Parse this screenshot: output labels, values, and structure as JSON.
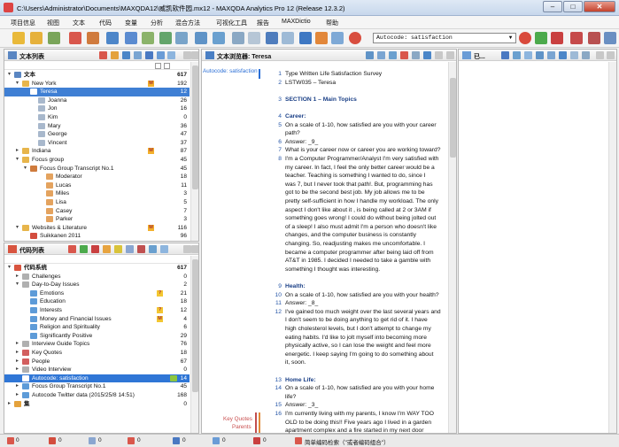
{
  "window": {
    "title": "C:\\Users\\Administrator\\Documents\\MAXQDA12\\威凯软件园.mx12 - MAXQDA Analytics Pro 12 (Release 12.3.2)",
    "minimize": "–",
    "maximize": "□",
    "close": "✕"
  },
  "menu": [
    "项目信息",
    "视图",
    "文本",
    "代码",
    "变量",
    "分析",
    "混合方法",
    "可视化工具",
    "报告",
    "MAXDictio",
    "帮助"
  ],
  "toolbar": {
    "code_select_value": "Autocode: satisfaction"
  },
  "doc_system": {
    "title": "文本列表",
    "rows": [
      {
        "label": "文本",
        "count": "617"
      },
      {
        "label": "New York",
        "count": "192"
      },
      {
        "label": "Teresa",
        "count": "12"
      },
      {
        "label": "Joanna",
        "count": "26"
      },
      {
        "label": "Jon",
        "count": "16"
      },
      {
        "label": "Kim",
        "count": "0"
      },
      {
        "label": "Mary",
        "count": "36"
      },
      {
        "label": "George",
        "count": "47"
      },
      {
        "label": "Vincent",
        "count": "37"
      },
      {
        "label": "Indiana",
        "count": "87"
      },
      {
        "label": "Focus group",
        "count": "45"
      },
      {
        "label": "Focus Group Transcript No.1",
        "count": "45"
      },
      {
        "label": "Moderator",
        "count": "18"
      },
      {
        "label": "Lucas",
        "count": "11"
      },
      {
        "label": "Miles",
        "count": "3"
      },
      {
        "label": "Lisa",
        "count": "5"
      },
      {
        "label": "Casey",
        "count": "7"
      },
      {
        "label": "Parker",
        "count": "3"
      },
      {
        "label": "Websites & Literature",
        "count": "116"
      },
      {
        "label": "Suikkanen 2011",
        "count": "96"
      }
    ]
  },
  "code_system": {
    "title": "代码列表",
    "rows": [
      {
        "label": "代码系统",
        "count": "617"
      },
      {
        "label": "Challenges",
        "count": "0"
      },
      {
        "label": "Day-to-Day Issues",
        "count": "2"
      },
      {
        "label": "Emotions",
        "count": "21"
      },
      {
        "label": "Education",
        "count": "18"
      },
      {
        "label": "Interests",
        "count": "12"
      },
      {
        "label": "Money and Financial Issues",
        "count": "4"
      },
      {
        "label": "Religion and Spirituality",
        "count": "6"
      },
      {
        "label": "Significantly Positive",
        "count": "29"
      },
      {
        "label": "Interview Guide Topics",
        "count": "76"
      },
      {
        "label": "Key Quotes",
        "count": "18"
      },
      {
        "label": "People",
        "count": "67"
      },
      {
        "label": "Video Interview",
        "count": "0"
      },
      {
        "label": "Autocode: satisfaction",
        "count": "14"
      },
      {
        "label": "Focus Group Transcript No.1",
        "count": "45"
      },
      {
        "label": "Autocode Twitter data (2015/25/8 14:51)",
        "count": "168"
      },
      {
        "label": "集",
        "count": "0"
      }
    ]
  },
  "doc_browser": {
    "title": "文本浏览器: Teresa",
    "code_label": "Autocode: satisfaction",
    "margin_label_1": "Key Quotes",
    "margin_label_2": "Parents",
    "lines": [
      {
        "n": "1",
        "t": "Type Written Life Satisfaction Survey",
        "b": false
      },
      {
        "n": "2",
        "t": "LSTW035 – Teresa",
        "b": false
      },
      {
        "n": "",
        "t": "",
        "b": false
      },
      {
        "n": "3",
        "t": "SECTION 1 – Main Topics",
        "b": true
      },
      {
        "n": "",
        "t": "",
        "b": false
      },
      {
        "n": "4",
        "t": "Career:",
        "b": true
      },
      {
        "n": "5",
        "t": "On a scale of 1-10, how satisfied are you with your career",
        "b": false
      },
      {
        "n": "",
        "t": "path?",
        "b": false
      },
      {
        "n": "6",
        "t": "Answer: _9_",
        "b": false
      },
      {
        "n": "7",
        "t": "What is your career now or career you are working toward?",
        "b": false
      },
      {
        "n": "8",
        "t": "I'm a Computer Programmer/Analyst I'm very satisfied with",
        "b": false
      },
      {
        "n": "",
        "t": "my career.  In fact, I feel the only better career would be a",
        "b": false
      },
      {
        "n": "",
        "t": "teacher.  Teaching is something I wanted to do, since I",
        "b": false
      },
      {
        "n": "",
        "t": "was 7, but I never took that path!. But, programming has",
        "b": false
      },
      {
        "n": "",
        "t": "got to be the second best job.  My job allows me to be",
        "b": false
      },
      {
        "n": "",
        "t": "pretty self-sufficient in how I handle my workload.  The only",
        "b": false
      },
      {
        "n": "",
        "t": "aspect I don't like about it , is being called at 2 or 3AM  if",
        "b": false
      },
      {
        "n": "",
        "t": "something goes wrong!  I could do without being jolted out",
        "b": false
      },
      {
        "n": "",
        "t": "of a sleep!  I also must admit I'm a person who doesn't like",
        "b": false
      },
      {
        "n": "",
        "t": "changes, and the computer business is constantly",
        "b": false
      },
      {
        "n": "",
        "t": "changing.  So, readjusting makes me uncomfortable.  I",
        "b": false
      },
      {
        "n": "",
        "t": "became a computer programmer after being laid off from",
        "b": false
      },
      {
        "n": "",
        "t": "AT&T in 1985.  I decided I needed to take a gamble with",
        "b": false
      },
      {
        "n": "",
        "t": "something I thought was interesting.",
        "b": false
      },
      {
        "n": "",
        "t": "",
        "b": false
      },
      {
        "n": "9",
        "t": "Health:",
        "b": true
      },
      {
        "n": "10",
        "t": "On a scale of 1-10, how satisfied are you with your health?",
        "b": false
      },
      {
        "n": "11",
        "t": "Answer: _8_",
        "b": false
      },
      {
        "n": "12",
        "t": "I've gained too much weight over the last several years and",
        "b": false
      },
      {
        "n": "",
        "t": "I don't seem to be doing anything to get rid of it.  I have",
        "b": false
      },
      {
        "n": "",
        "t": "high cholesterol levels, but I don't attempt to change my",
        "b": false
      },
      {
        "n": "",
        "t": "eating habits.  I'd like to jolt myself into becoming more",
        "b": false
      },
      {
        "n": "",
        "t": "physically active, so I can lose the weight and feel more",
        "b": false
      },
      {
        "n": "",
        "t": "energetic.  I keep saying I'm going to do something about",
        "b": false
      },
      {
        "n": "",
        "t": "it, soon.",
        "b": false
      },
      {
        "n": "",
        "t": "",
        "b": false
      },
      {
        "n": "13",
        "t": "Home Life:",
        "b": true
      },
      {
        "n": "14",
        "t": "On a scale of 1-10, how satisfied are you with your home",
        "b": false
      },
      {
        "n": "",
        "t": "life?",
        "b": false
      },
      {
        "n": "15",
        "t": "Answer: _3_",
        "b": false
      },
      {
        "n": "16",
        "t": "I'm currently living with my parents, I know I'm WAY TOO",
        "b": false
      },
      {
        "n": "",
        "t": "OLD to be doing this!!  Five years ago I lived in a garden",
        "b": false
      },
      {
        "n": "",
        "t": "apartment complex and a fire started in my next door",
        "b": false
      }
    ]
  },
  "retrieved": {
    "title": "已..."
  },
  "status": {
    "items": [
      "0",
      "0",
      "0",
      "0",
      "0",
      "0",
      "0"
    ],
    "hint": "简单编码检索（\"或者编码组合\"）"
  }
}
